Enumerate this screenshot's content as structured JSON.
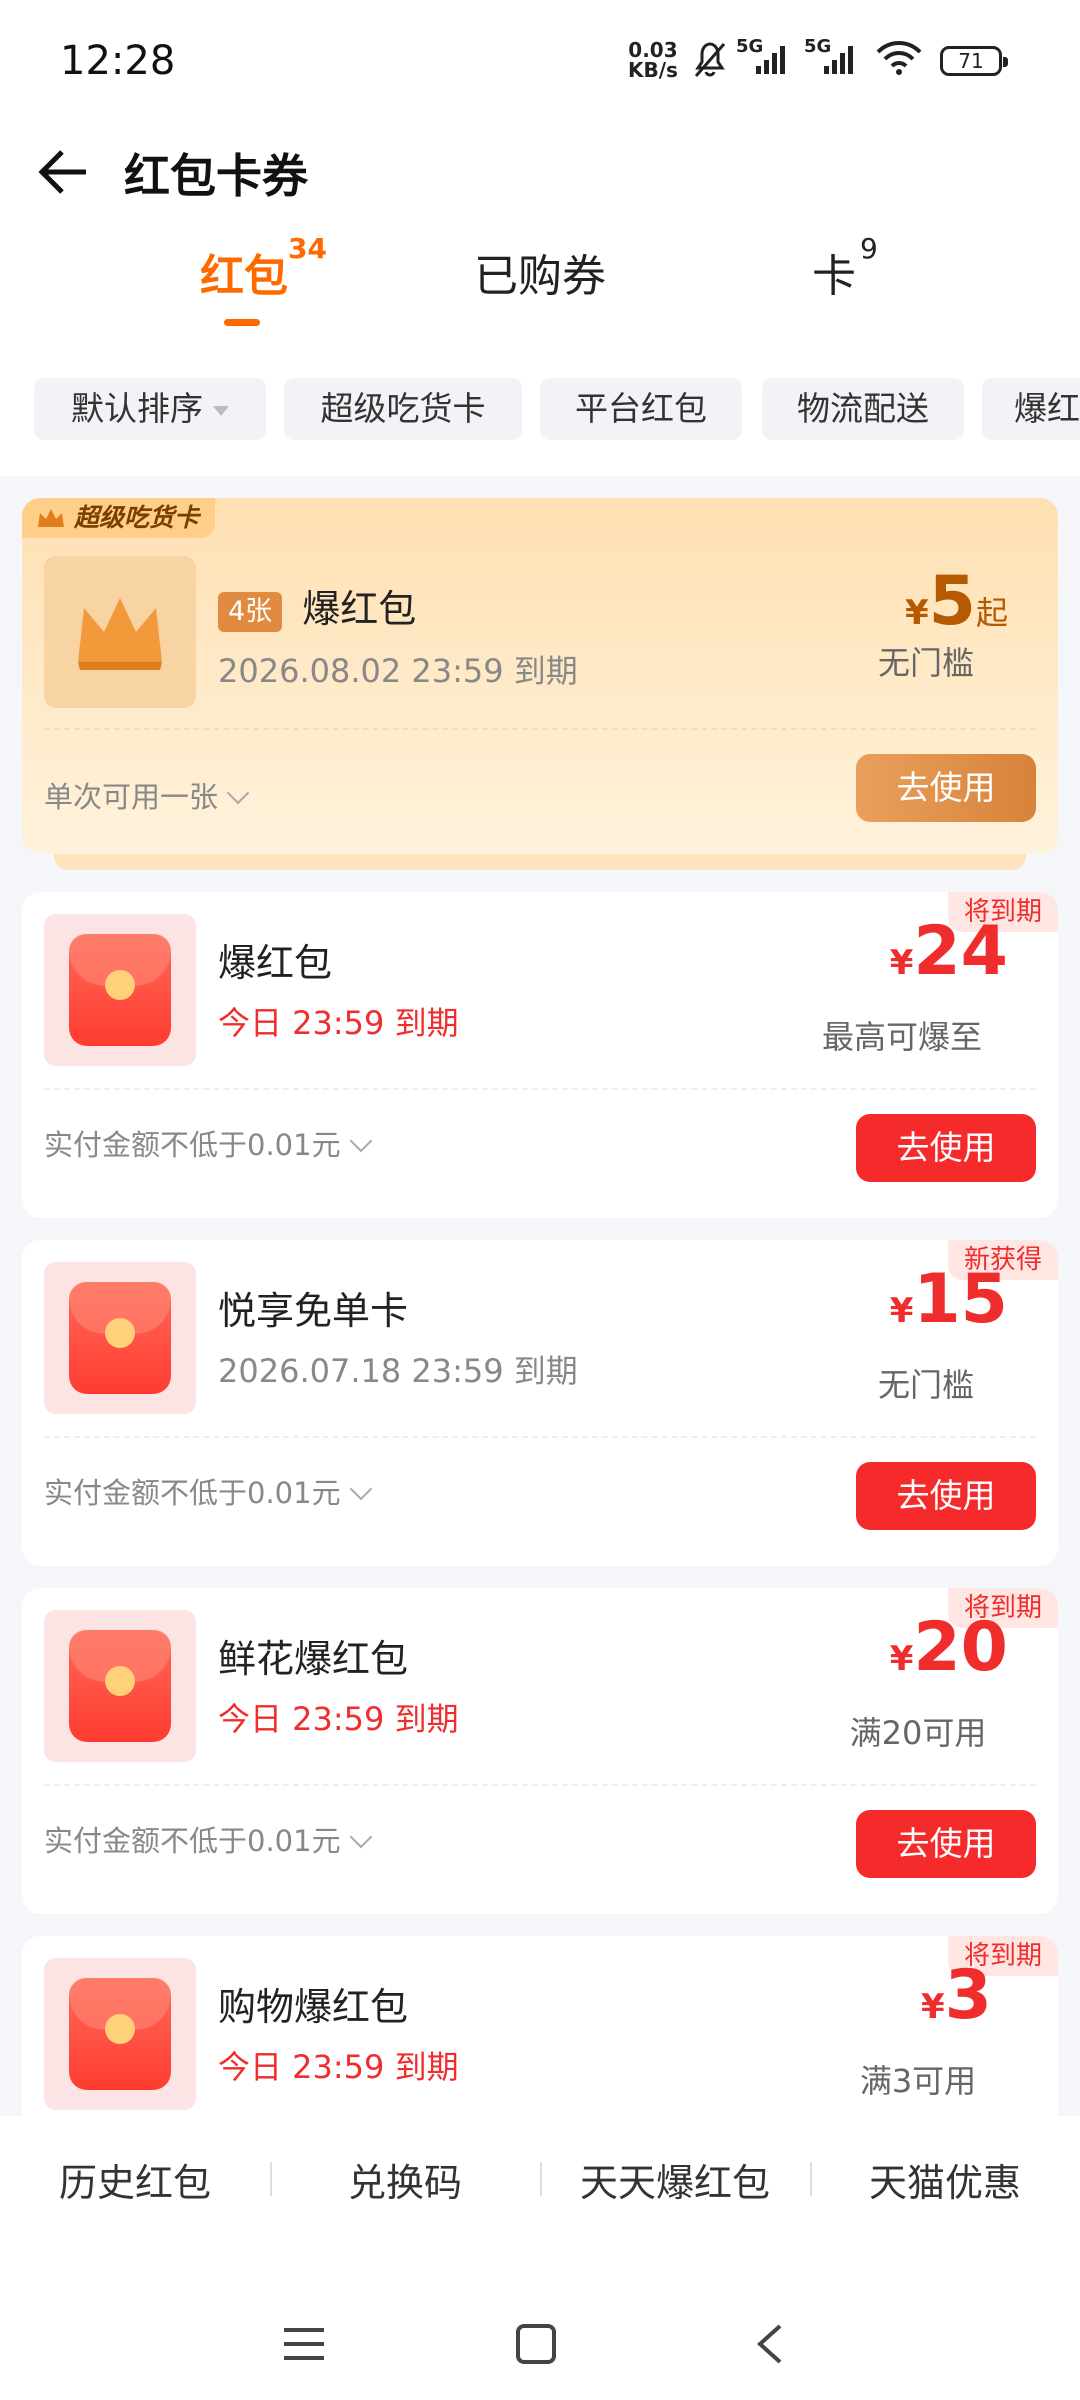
{
  "status": {
    "time": "12:28",
    "net_speed_value": "0.03",
    "net_speed_unit": "KB/s",
    "sim1": "5G",
    "sim2": "5G",
    "battery": "71"
  },
  "header": {
    "title": "红包卡券"
  },
  "tabs": [
    {
      "label": "红包",
      "count": "34"
    },
    {
      "label": "已购券",
      "count": ""
    },
    {
      "label": "卡",
      "count": "9"
    }
  ],
  "chips": [
    "默认排序",
    "超级吃货卡",
    "平台红包",
    "物流配送",
    "爆红"
  ],
  "super_card": {
    "tag": "超级吃货卡",
    "count": "4张",
    "name": "爆红包",
    "expire": "2026.08.02 23:59 到期",
    "yen": "¥",
    "amount": "5",
    "suffix": "起",
    "cond": "无门槛",
    "rule": "单次可用一张",
    "button": "去使用"
  },
  "coupons": [
    {
      "badge": "将到期",
      "name": "爆红包",
      "expire": "今日 23:59 到期",
      "yen": "¥",
      "amount": "24",
      "cond": "最高可爆至",
      "rule": "实付金额不低于0.01元",
      "button": "去使用"
    },
    {
      "badge": "新获得",
      "name": "悦享免单卡",
      "expire": "2026.07.18 23:59 到期",
      "yen": "¥",
      "amount": "15",
      "cond": "无门槛",
      "rule": "实付金额不低于0.01元",
      "button": "去使用"
    },
    {
      "badge": "将到期",
      "name": "鲜花爆红包",
      "expire": "今日 23:59 到期",
      "yen": "¥",
      "amount": "20",
      "cond": "满20可用",
      "rule": "实付金额不低于0.01元",
      "button": "去使用"
    },
    {
      "badge": "将到期",
      "name": "购物爆红包",
      "expire": "今日 23:59 到期",
      "yen": "¥",
      "amount": "3",
      "cond": "满3可用"
    }
  ],
  "bottom_nav": [
    "历史红包",
    "兑换码",
    "天天爆红包",
    "天猫优惠"
  ],
  "colors": {
    "accent": "#ff6a00",
    "red": "#f02d2d"
  }
}
